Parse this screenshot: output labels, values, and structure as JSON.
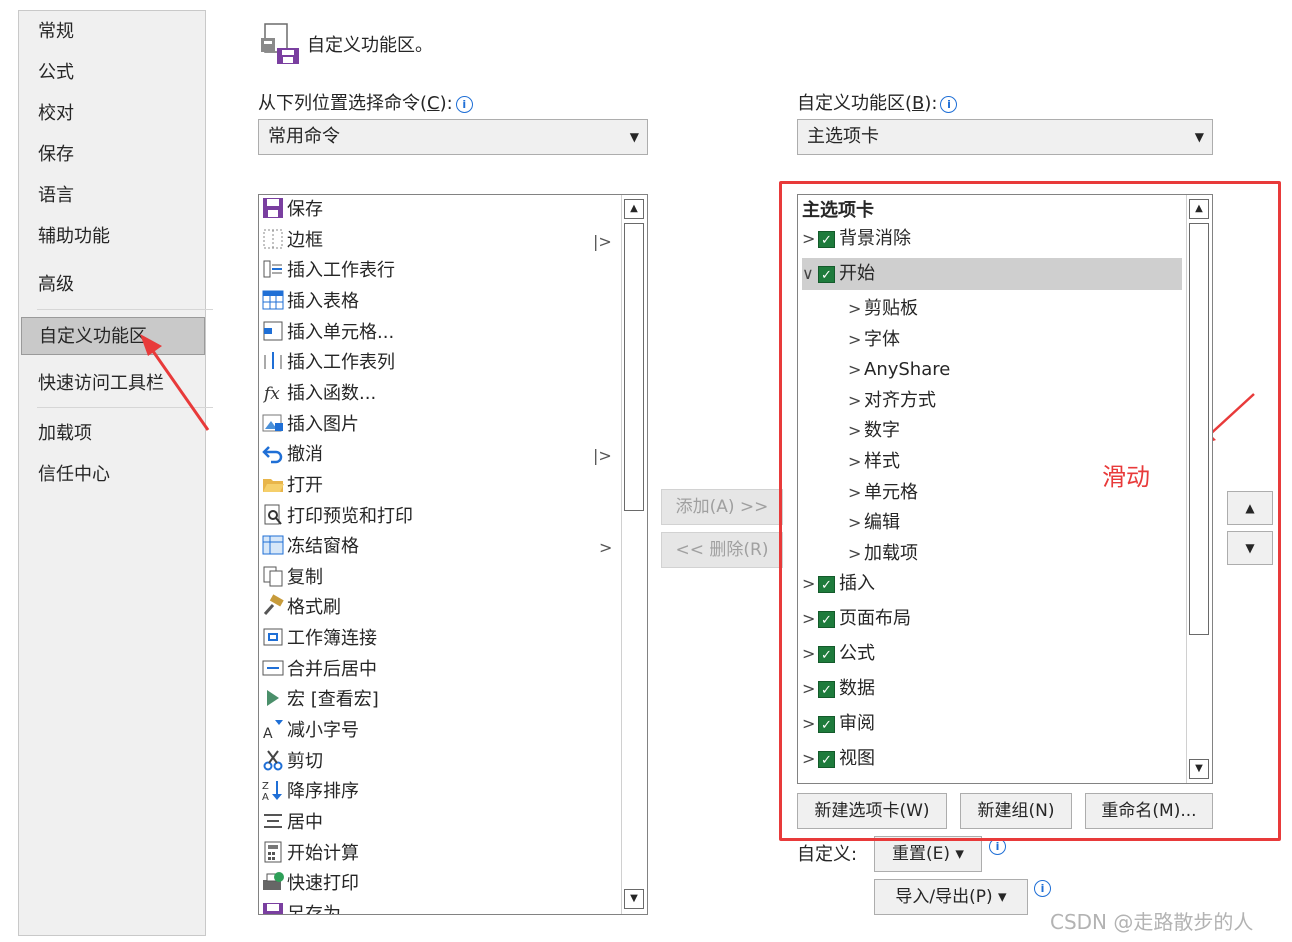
{
  "nav": {
    "items": [
      {
        "label": "常规"
      },
      {
        "label": "公式"
      },
      {
        "label": "校对"
      },
      {
        "label": "保存"
      },
      {
        "label": "语言"
      },
      {
        "label": "辅助功能"
      },
      {
        "label": "高级"
      },
      {
        "label": "自定义功能区",
        "selected": true
      },
      {
        "label": "快速访问工具栏"
      },
      {
        "label": "加载项"
      },
      {
        "label": "信任中心"
      }
    ]
  },
  "header": {
    "title": "自定义功能区。"
  },
  "commands_source": {
    "label": "从下列位置选择命令(",
    "accel": "C",
    "label_end": "):",
    "selected": "常用命令"
  },
  "ribbon_target": {
    "label": "自定义功能区(",
    "accel": "B",
    "label_end": "):",
    "selected": "主选项卡"
  },
  "commands": [
    {
      "icon": "save-icon",
      "label": "保存"
    },
    {
      "icon": "border-icon",
      "label": "边框",
      "submenu": "|>"
    },
    {
      "icon": "insert-row-icon",
      "label": "插入工作表行"
    },
    {
      "icon": "insert-table-icon",
      "label": "插入表格"
    },
    {
      "icon": "insert-cell-icon",
      "label": "插入单元格..."
    },
    {
      "icon": "insert-column-icon",
      "label": "插入工作表列"
    },
    {
      "icon": "function-icon",
      "label": "插入函数..."
    },
    {
      "icon": "picture-icon",
      "label": "插入图片"
    },
    {
      "icon": "undo-icon",
      "label": "撤消",
      "submenu": "|>"
    },
    {
      "icon": "folder-open-icon",
      "label": "打开"
    },
    {
      "icon": "print-preview-icon",
      "label": "打印预览和打印"
    },
    {
      "icon": "freeze-panes-icon",
      "label": "冻结窗格",
      "submenu": ">"
    },
    {
      "icon": "copy-icon",
      "label": "复制"
    },
    {
      "icon": "format-painter-icon",
      "label": "格式刷"
    },
    {
      "icon": "workbook-link-icon",
      "label": "工作簿连接"
    },
    {
      "icon": "merge-center-icon",
      "label": "合并后居中"
    },
    {
      "icon": "macro-icon",
      "label": "宏 [查看宏]"
    },
    {
      "icon": "decrease-font-icon",
      "label": "减小字号"
    },
    {
      "icon": "cut-icon",
      "label": "剪切"
    },
    {
      "icon": "sort-desc-icon",
      "label": "降序排序"
    },
    {
      "icon": "align-center-icon",
      "label": "居中"
    },
    {
      "icon": "calculate-icon",
      "label": "开始计算"
    },
    {
      "icon": "quick-print-icon",
      "label": "快速打印"
    },
    {
      "icon": "save-as-icon",
      "label": "另存为"
    }
  ],
  "middle_buttons": {
    "add": "添加(A) >>",
    "remove": "<< 删除(R)"
  },
  "tree": {
    "header": "主选项卡",
    "items": [
      {
        "chev": ">",
        "checked": true,
        "label": "背景消除",
        "level": 0
      },
      {
        "chev": "∨",
        "checked": true,
        "label": "开始",
        "level": 0,
        "selected": true
      },
      {
        "chev": ">",
        "label": "剪贴板",
        "level": 1
      },
      {
        "chev": ">",
        "label": "字体",
        "level": 1
      },
      {
        "chev": ">",
        "label": "AnyShare",
        "level": 1
      },
      {
        "chev": ">",
        "label": "对齐方式",
        "level": 1
      },
      {
        "chev": ">",
        "label": "数字",
        "level": 1
      },
      {
        "chev": ">",
        "label": "样式",
        "level": 1
      },
      {
        "chev": ">",
        "label": "单元格",
        "level": 1
      },
      {
        "chev": ">",
        "label": "编辑",
        "level": 1
      },
      {
        "chev": ">",
        "label": "加载项",
        "level": 1
      },
      {
        "chev": ">",
        "checked": true,
        "label": "插入",
        "level": 0
      },
      {
        "chev": ">",
        "checked": true,
        "label": "页面布局",
        "level": 0
      },
      {
        "chev": ">",
        "checked": true,
        "label": "公式",
        "level": 0
      },
      {
        "chev": ">",
        "checked": true,
        "label": "数据",
        "level": 0
      },
      {
        "chev": ">",
        "checked": true,
        "label": "审阅",
        "level": 0
      },
      {
        "chev": ">",
        "checked": true,
        "label": "视图",
        "level": 0
      }
    ]
  },
  "tree_buttons": {
    "new_tab": "新建选项卡(W)",
    "new_group": "新建组(N)",
    "rename": "重命名(M)..."
  },
  "customize": {
    "label": "自定义:",
    "reset": "重置(E) ▾",
    "import_export": "导入/导出(P) ▾"
  },
  "annotation": "滑动",
  "watermark": "CSDN @走路散步的人",
  "colors": {
    "annotation_red": "#e83a3a",
    "checkbox_green": "#1e7b3c",
    "info_blue": "#1f6fd6"
  }
}
